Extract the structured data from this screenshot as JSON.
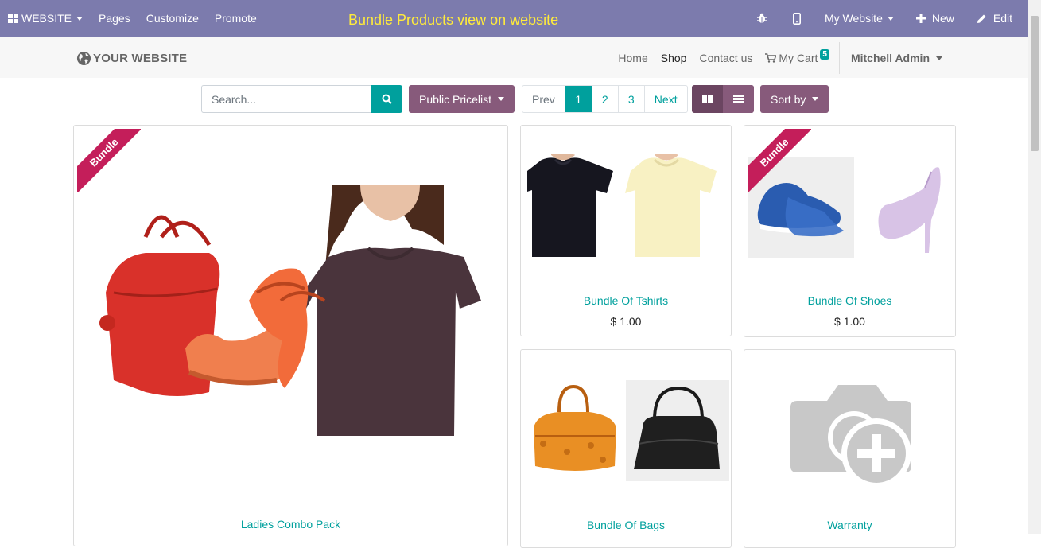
{
  "topbar": {
    "brand": "WEBSITE",
    "menu": [
      "Pages",
      "Customize",
      "Promote"
    ],
    "banner": "Bundle Products view on website",
    "my_website": "My Website",
    "new_label": "New",
    "edit_label": "Edit"
  },
  "navbar": {
    "logo_text": "YOUR WEBSITE",
    "links": [
      "Home",
      "Shop",
      "Contact us"
    ],
    "cart_label": "My Cart",
    "cart_count": "5",
    "user": "Mitchell Admin"
  },
  "toolbar": {
    "search_placeholder": "Search...",
    "pricelist": "Public Pricelist",
    "pager": {
      "prev": "Prev",
      "pages": [
        "1",
        "2",
        "3"
      ],
      "next": "Next",
      "current": "1"
    },
    "sort": "Sort by"
  },
  "products": [
    {
      "name": "Ladies Combo Pack",
      "ribbon": "Bundle"
    },
    {
      "name": "Bundle Of Tshirts",
      "price": "$ 1.00"
    },
    {
      "name": "Bundle Of Shoes",
      "price": "$ 1.00",
      "ribbon": "Bundle"
    },
    {
      "name": "Bundle Of Bags"
    },
    {
      "name": "Warranty"
    }
  ],
  "colors": {
    "admin_bar": "#7c7bad",
    "banner_text": "#ffeb3b",
    "accent": "#00a09d",
    "purple": "#875a7b",
    "ribbon": "#c41e5a"
  }
}
